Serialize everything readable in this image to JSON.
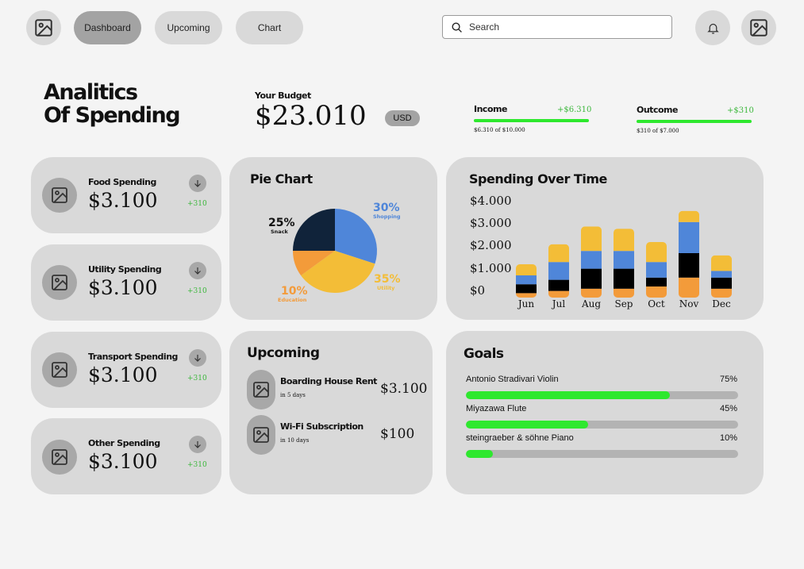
{
  "nav": {
    "tabs": [
      {
        "label": "Dashboard",
        "active": true
      },
      {
        "label": "Upcoming",
        "active": false
      },
      {
        "label": "Chart",
        "active": false
      }
    ],
    "search_placeholder": "Search"
  },
  "header": {
    "title_line1": "Analitics",
    "title_line2": "Of Spending",
    "budget_label": "Your Budget",
    "budget_value": "$23.010",
    "currency": "USD",
    "income": {
      "label": "Income",
      "delta": "+$6.310",
      "detail": "$6.310 of $10.000",
      "progress": 1.0
    },
    "outcome": {
      "label": "Outcome",
      "delta": "+$310",
      "detail": "$310 of $7.000",
      "progress": 1.0
    }
  },
  "spending_cards": [
    {
      "label": "Food Spending",
      "value": "$3.100",
      "delta": "+310"
    },
    {
      "label": "Utility Spending",
      "value": "$3.100",
      "delta": "+310"
    },
    {
      "label": "Transport Spending",
      "value": "$3.100",
      "delta": "+310"
    },
    {
      "label": "Other Spending",
      "value": "$3.100",
      "delta": "+310"
    }
  ],
  "pie": {
    "title": "Pie Chart",
    "slices": [
      {
        "pct": "30%",
        "name": "Shopping",
        "value": 30,
        "color": "#4f86d9"
      },
      {
        "pct": "35%",
        "name": "Utility",
        "value": 35,
        "color": "#f3bd37"
      },
      {
        "pct": "10%",
        "name": "Education",
        "value": 10,
        "color": "#f39b3a"
      },
      {
        "pct": "25%",
        "name": "Snack",
        "value": 25,
        "color": "#10233a"
      }
    ]
  },
  "spending_chart": {
    "title": "Spending Over Time",
    "y_ticks": [
      "$4.000",
      "$3.000",
      "$2.000",
      "$1.000",
      "$0"
    ],
    "months": [
      "Jun",
      "Jul",
      "Aug",
      "Sep",
      "Oct",
      "Nov",
      "Dec"
    ]
  },
  "chart_data": {
    "type": "bar",
    "stacked": true,
    "categories": [
      "Jun",
      "Jul",
      "Aug",
      "Sep",
      "Oct",
      "Nov",
      "Dec"
    ],
    "ylim": [
      0,
      4000
    ],
    "grid": false,
    "series": [
      {
        "color": "#f39b3a",
        "values": [
          200,
          300,
          400,
          400,
          500,
          900,
          400
        ]
      },
      {
        "color": "#000000",
        "values": [
          400,
          500,
          900,
          900,
          400,
          1100,
          500
        ]
      },
      {
        "color": "#4f86d9",
        "values": [
          400,
          800,
          800,
          800,
          700,
          1400,
          300
        ]
      },
      {
        "color": "#f3bd37",
        "values": [
          500,
          800,
          1100,
          1000,
          900,
          500,
          700
        ]
      }
    ]
  },
  "upcoming": {
    "title": "Upcoming",
    "items": [
      {
        "name": "Boarding House Rent",
        "due": "in 5 days",
        "amount": "$3.100"
      },
      {
        "name": "Wi-Fi Subscription",
        "due": "in 10 days",
        "amount": "$100"
      }
    ]
  },
  "goals": {
    "title": "Goals",
    "items": [
      {
        "name": "Antonio Stradivari Violin",
        "pct": "75%",
        "progress": 0.75
      },
      {
        "name": "Miyazawa Flute",
        "pct": "45%",
        "progress": 0.45
      },
      {
        "name": "steingraeber & söhne Piano",
        "pct": "10%",
        "progress": 0.1
      }
    ]
  },
  "colors": {
    "accent_green": "#2ee82e",
    "positive_text": "#3bb73b",
    "card_bg": "#d9d9d9"
  }
}
